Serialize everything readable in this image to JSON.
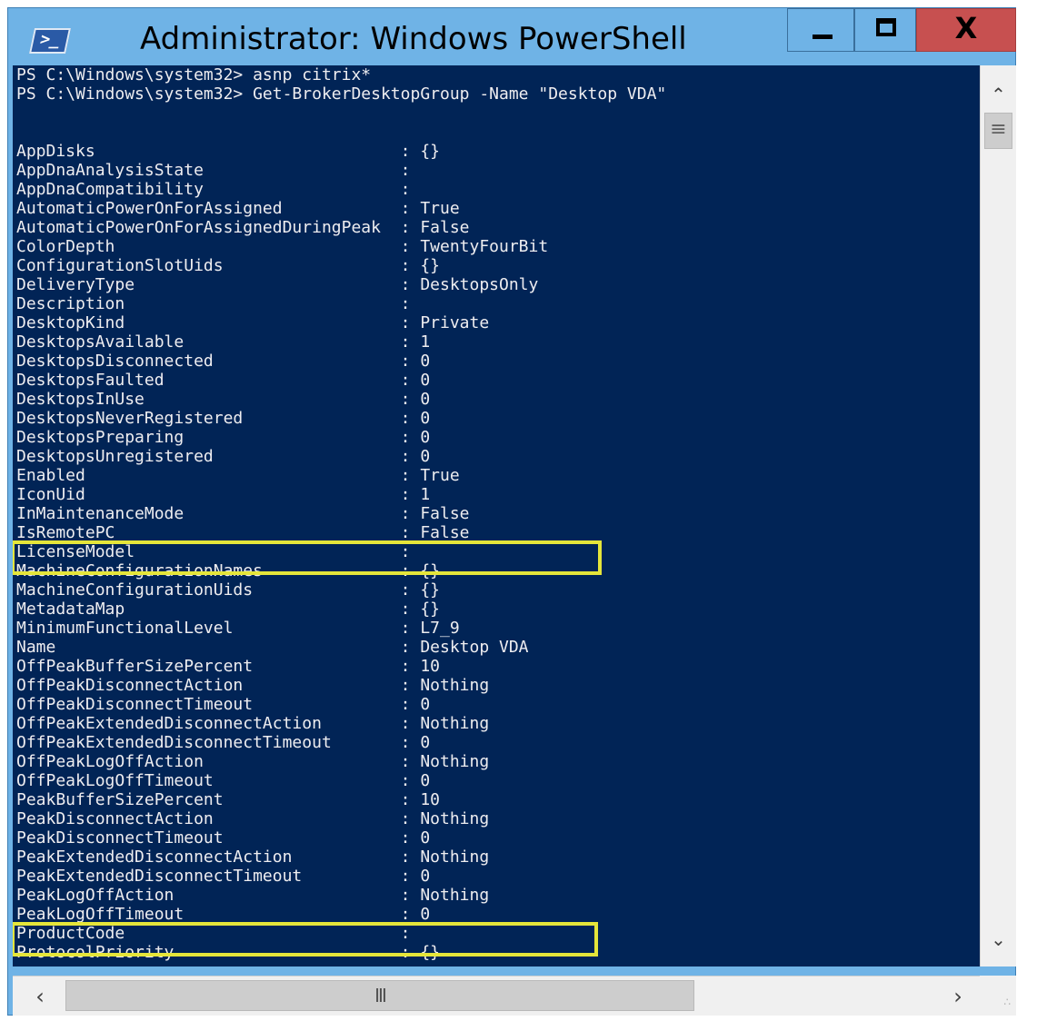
{
  "window": {
    "title": "Administrator: Windows PowerShell",
    "app_icon_glyph": ">_",
    "controls": {
      "minimize": "minimize-icon",
      "maximize": "maximize-icon",
      "close_glyph": "X"
    },
    "colors": {
      "titlebar": "#6fb3e6",
      "console_bg": "#012456",
      "console_fg": "#eeedf0",
      "highlight_box": "#e5e53a",
      "close_button": "#c75050"
    }
  },
  "console": {
    "lines": [
      "PS C:\\Windows\\system32> asnp citrix*",
      "PS C:\\Windows\\system32> Get-BrokerDesktopGroup -Name \"Desktop VDA\"",
      "",
      "",
      "AppDisks                               : {}",
      "AppDnaAnalysisState                    :",
      "AppDnaCompatibility                    :",
      "AutomaticPowerOnForAssigned            : True",
      "AutomaticPowerOnForAssignedDuringPeak  : False",
      "ColorDepth                             : TwentyFourBit",
      "ConfigurationSlotUids                  : {}",
      "DeliveryType                           : DesktopsOnly",
      "Description                            :",
      "DesktopKind                            : Private",
      "DesktopsAvailable                      : 1",
      "DesktopsDisconnected                   : 0",
      "DesktopsFaulted                        : 0",
      "DesktopsInUse                          : 0",
      "DesktopsNeverRegistered                : 0",
      "DesktopsPreparing                      : 0",
      "DesktopsUnregistered                   : 0",
      "Enabled                                : True",
      "IconUid                                : 1",
      "InMaintenanceMode                      : False",
      "IsRemotePC                             : False",
      "LicenseModel                           :",
      "MachineConfigurationNames              : {}",
      "MachineConfigurationUids               : {}",
      "MetadataMap                            : {}",
      "MinimumFunctionalLevel                 : L7_9",
      "Name                                   : Desktop VDA",
      "OffPeakBufferSizePercent               : 10",
      "OffPeakDisconnectAction                : Nothing",
      "OffPeakDisconnectTimeout               : 0",
      "OffPeakExtendedDisconnectAction        : Nothing",
      "OffPeakExtendedDisconnectTimeout       : 0",
      "OffPeakLogOffAction                    : Nothing",
      "OffPeakLogOffTimeout                   : 0",
      "PeakBufferSizePercent                  : 10",
      "PeakDisconnectAction                   : Nothing",
      "PeakDisconnectTimeout                  : 0",
      "PeakExtendedDisconnectAction           : Nothing",
      "PeakExtendedDisconnectTimeout          : 0",
      "PeakLogOffAction                       : Nothing",
      "PeakLogOffTimeout                      : 0",
      "ProductCode                            :",
      "ProtocolPriority                       : {}"
    ],
    "highlighted_properties": [
      "LicenseModel",
      "ProductCode"
    ]
  },
  "scrollbars": {
    "vertical": {
      "up": "chevron-up-icon",
      "down": "chevron-down-icon",
      "thumb_grip": "≡"
    },
    "horizontal": {
      "left": "chevron-left-icon",
      "right": "chevron-right-icon",
      "thumb_grip": "III"
    }
  }
}
